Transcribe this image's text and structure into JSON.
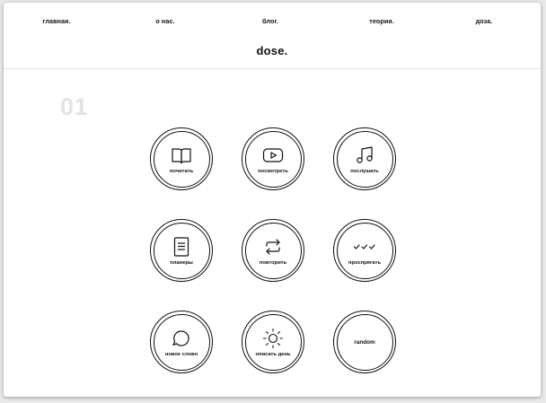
{
  "nav": {
    "items": [
      {
        "label": "главная."
      },
      {
        "label": "о нас."
      },
      {
        "label": "блог."
      },
      {
        "label": "теория."
      },
      {
        "label": "доза."
      }
    ]
  },
  "logo": "dose.",
  "section_number": "01",
  "tiles": [
    {
      "label": "почитать",
      "icon": "book-icon"
    },
    {
      "label": "посмотреть",
      "icon": "video-play-icon"
    },
    {
      "label": "послушать",
      "icon": "music-note-icon"
    },
    {
      "label": "планеры",
      "icon": "planner-document-icon"
    },
    {
      "label": "повторить",
      "icon": "repeat-icon"
    },
    {
      "label": "проспрягать",
      "icon": "triple-check-icon"
    },
    {
      "label": "новое слово",
      "icon": "speech-bubble-icon"
    },
    {
      "label": "описать день",
      "icon": "sun-icon"
    },
    {
      "label": "random",
      "icon": ""
    }
  ]
}
